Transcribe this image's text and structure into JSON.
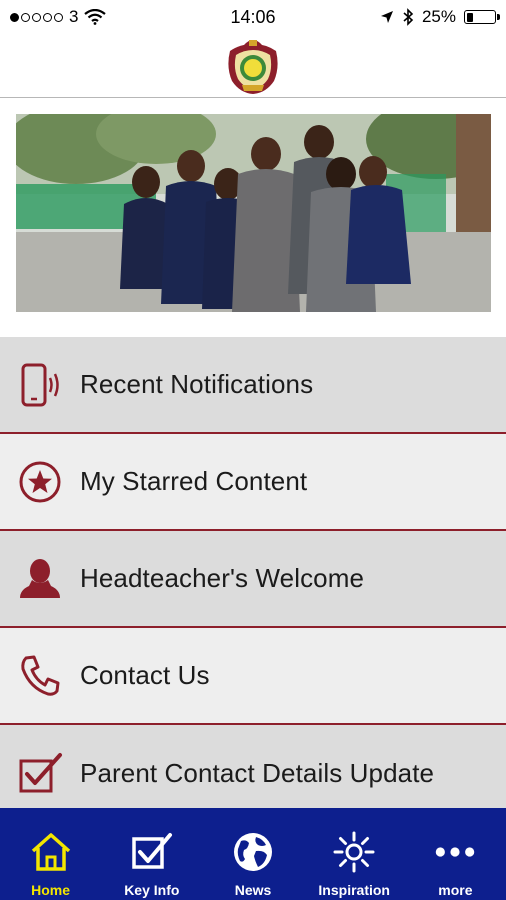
{
  "status_bar": {
    "carrier": "3",
    "time": "14:06",
    "battery_percent": "25%",
    "battery_level": 0.25
  },
  "header": {
    "logo_icon": "school-crest-logo"
  },
  "hero": {
    "image_description": "photo"
  },
  "menu": {
    "accent_color": "#8d1f2b",
    "items": [
      {
        "label": "Recent Notifications",
        "icon": "phone-notification-icon"
      },
      {
        "label": "My Starred Content",
        "icon": "star-circle-icon"
      },
      {
        "label": "Headteacher's Welcome",
        "icon": "person-icon"
      },
      {
        "label": "Contact Us",
        "icon": "telephone-icon"
      },
      {
        "label": "Parent Contact Details Update",
        "icon": "checkbox-icon"
      }
    ]
  },
  "tab_bar": {
    "background": "#0d1f8e",
    "active_color": "#f3e600",
    "tabs": [
      {
        "label": "Home",
        "icon": "home-icon",
        "active": true
      },
      {
        "label": "Key Info",
        "icon": "checkbox-icon",
        "active": false
      },
      {
        "label": "News",
        "icon": "globe-icon",
        "active": false
      },
      {
        "label": "Inspiration",
        "icon": "sun-icon",
        "active": false
      },
      {
        "label": "more",
        "icon": "more-dots-icon",
        "active": false
      }
    ]
  }
}
